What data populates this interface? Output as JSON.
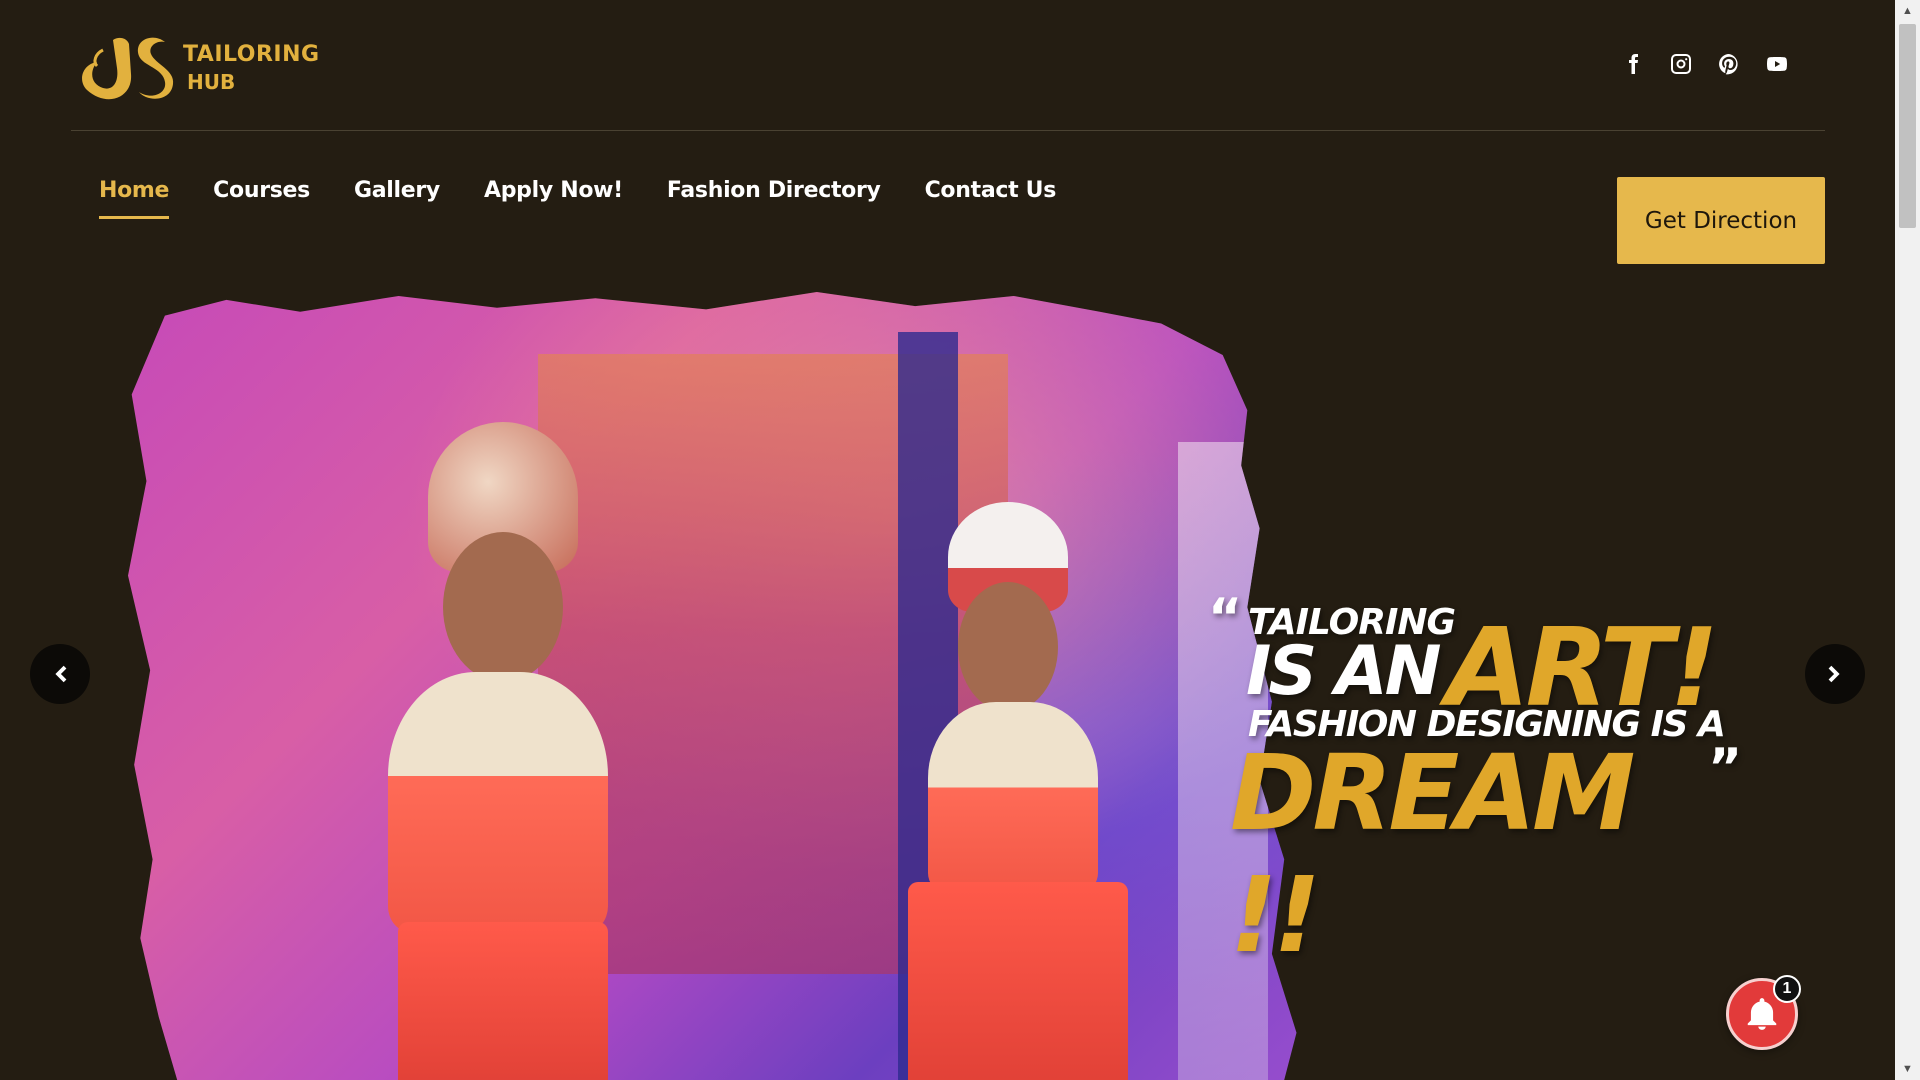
{
  "brand": {
    "logo_monogram": "JS",
    "name_line1": "TAILORING",
    "name_line2": "HUB",
    "accent_color": "#e6b84c"
  },
  "socials": [
    {
      "icon": "facebook-icon"
    },
    {
      "icon": "instagram-icon"
    },
    {
      "icon": "pinterest-icon"
    },
    {
      "icon": "youtube-icon"
    }
  ],
  "nav": {
    "items": [
      {
        "label": "Home",
        "active": true
      },
      {
        "label": "Courses",
        "active": false
      },
      {
        "label": "Gallery",
        "active": false
      },
      {
        "label": "Apply Now!",
        "active": false
      },
      {
        "label": "Fashion Directory",
        "active": false
      },
      {
        "label": "Contact Us",
        "active": false
      }
    ],
    "cta_label": "Get Direction"
  },
  "hero": {
    "quote_line1": "TAILORING",
    "quote_line2": "IS AN",
    "quote_highlight1": "ART!",
    "quote_line3": "FASHION DESIGNING IS A",
    "quote_highlight2": "DREAM !!",
    "open_quote": "“",
    "close_quote": "”"
  },
  "carousel": {
    "prev_icon": "chevron-left-icon",
    "next_icon": "chevron-right-icon"
  },
  "notification": {
    "icon": "bell-icon",
    "count": "1"
  }
}
